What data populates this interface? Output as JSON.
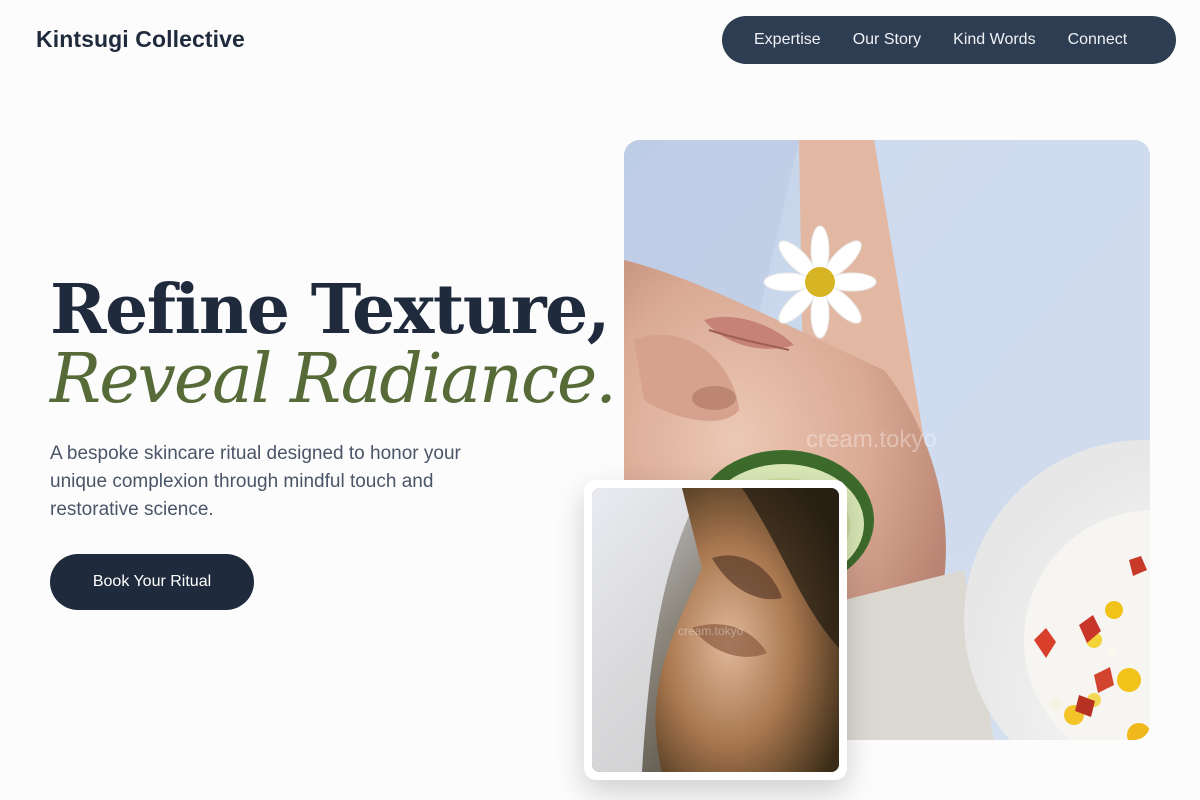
{
  "header": {
    "brand": "Kintsugi Collective",
    "nav": [
      "Expertise",
      "Our Story",
      "Kind Words",
      "Connect"
    ]
  },
  "hero": {
    "title_line1": "Refine Texture,",
    "title_line2": "Reveal Radiance.",
    "subtitle": "A bespoke skincare ritual designed to honor your unique complexion through mindful touch and restorative science.",
    "cta_label": "Book Your Ritual"
  },
  "images": {
    "main_watermark": "cream.tokyo",
    "secondary_watermark": "cream.tokyo"
  },
  "colors": {
    "navy": "#1f2a3c",
    "nav_bg": "#2f3d52",
    "accent_green": "#566b38",
    "body_text": "#4a5568"
  }
}
